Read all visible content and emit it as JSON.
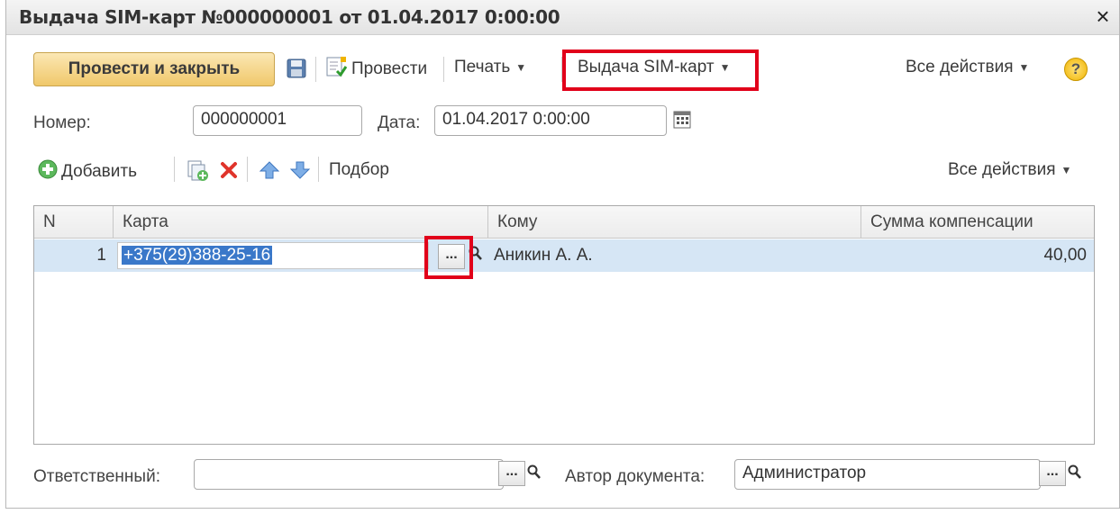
{
  "window": {
    "title": "Выдача SIM-карт №000000001 от 01.04.2017 0:00:00",
    "close_glyph": "×"
  },
  "toolbar": {
    "post_close_label": "Провести и закрыть",
    "post_label": "Провести",
    "print_label": "Печать",
    "issue_sim_label": "Выдача SIM-карт",
    "all_actions_label": "Все действия",
    "help_glyph": "?"
  },
  "header_fields": {
    "number_label": "Номер:",
    "number_value": "000000001",
    "date_label": "Дата:",
    "date_value": "01.04.2017  0:00:00"
  },
  "table_toolbar": {
    "add_label": "Добавить",
    "pick_label": "Подбор",
    "all_actions_label": "Все действия"
  },
  "table": {
    "columns": [
      "N",
      "Карта",
      "Кому",
      "Сумма компенсации"
    ],
    "rows": [
      {
        "n": "1",
        "card": "+375(29)388-25-16",
        "recipient": "Аникин А. А.",
        "compensation": "40,00"
      }
    ]
  },
  "footer": {
    "responsible_label": "Ответственный:",
    "responsible_value": "",
    "author_label": "Автор документа:",
    "author_value": "Администратор"
  },
  "icons": {
    "save": "floppy-disk-icon",
    "post": "post-document-icon",
    "add": "add-circle-icon",
    "copy": "copy-row-icon",
    "delete": "delete-x-icon",
    "up": "move-up-arrow-icon",
    "down": "move-down-arrow-icon",
    "calendar": "calendar-icon",
    "search": "magnifier-icon"
  },
  "colors": {
    "highlight_box": "#e1001a",
    "primary_button": "#f0c86a",
    "row_selected": "#d6e6f5",
    "text_selection": "#3a78c9"
  }
}
